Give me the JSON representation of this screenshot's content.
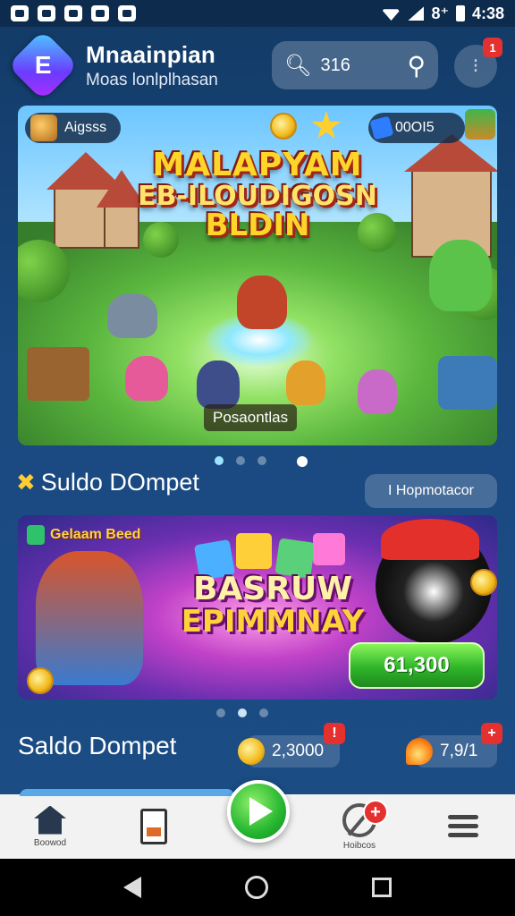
{
  "status_bar": {
    "time": "4:38",
    "signal_glyph": "8⁺"
  },
  "header": {
    "app_title": "Mnaainpian",
    "app_subtitle": "Moas lonlplhasan",
    "logo_letter": "E",
    "search_value": "316",
    "notif_count": "1"
  },
  "hero": {
    "title_line1": "MALAPYAM",
    "title_line2": "EB-ILOUDIGOSN",
    "title_line3": "BLDIN",
    "chip_left": "Aigsss",
    "chip_right": "00OI5",
    "caption": "Posaontlas",
    "dots": 4,
    "active_dot": 3
  },
  "section1": {
    "icon": "✖",
    "title": "Suldo DOmpet",
    "button_label": "I Hopmotacor"
  },
  "promo": {
    "chip": "Gelaam Beed",
    "title_line1": "BASRUW",
    "title_line2": "EPIMMNAY",
    "cta_value": "61,300"
  },
  "section2": {
    "title": "Saldo Dompet",
    "coins": {
      "value": "2,3000",
      "badge": "!"
    },
    "fire": {
      "value": "7,9/1",
      "badge": "+"
    }
  },
  "bottom_nav": {
    "items": [
      {
        "label": "Boowod",
        "icon": "home-icon"
      },
      {
        "label": "",
        "icon": "document-icon"
      },
      {
        "label": "",
        "icon": "play-icon"
      },
      {
        "label": "Hoibcos",
        "icon": "no-entry-icon",
        "badge": "+"
      },
      {
        "label": "",
        "icon": "menu-icon"
      }
    ]
  },
  "colors": {
    "background": "#1a4a80",
    "accent_green": "#25b630",
    "badge_red": "#e53030",
    "title_gold": "#ffd52a"
  }
}
